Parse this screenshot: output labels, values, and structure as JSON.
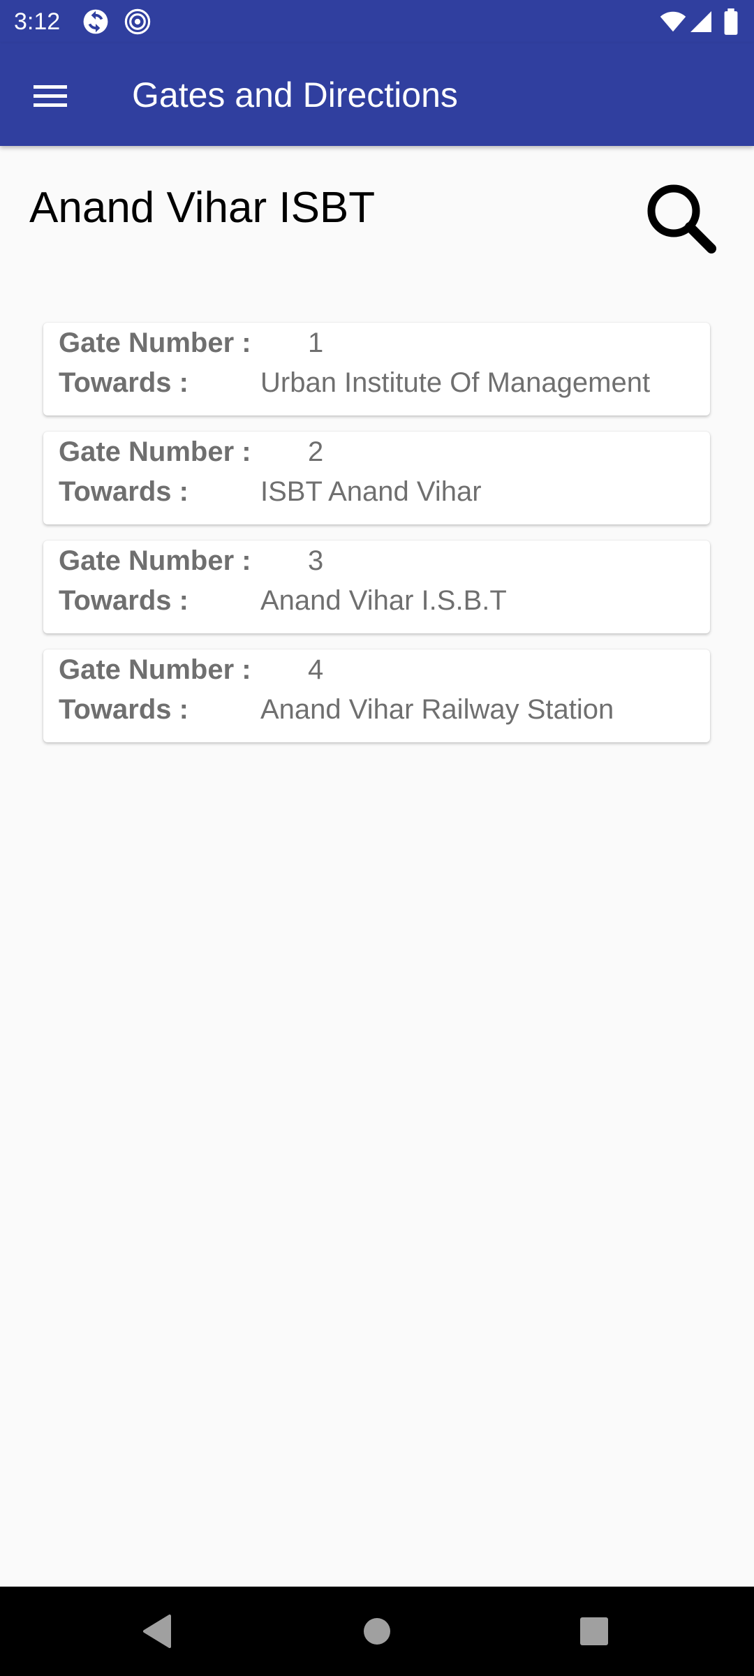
{
  "status_bar": {
    "time": "3:12",
    "left_icons": [
      "sync-icon",
      "hotspot-icon"
    ],
    "right_icons": [
      "wifi-icon",
      "cellular-signal-icon",
      "battery-icon"
    ]
  },
  "app_bar": {
    "title": "Gates and Directions",
    "menu_icon": "hamburger-menu-icon",
    "background_color": "#303f9f"
  },
  "station": {
    "name": "Anand Vihar ISBT",
    "search_icon": "search-icon"
  },
  "gates": [
    {
      "gate_label": "Gate Number :",
      "gate_number": "1",
      "towards_label": "Towards :",
      "towards": "Urban Institute Of Management"
    },
    {
      "gate_label": "Gate Number :",
      "gate_number": "2",
      "towards_label": "Towards :",
      "towards": "ISBT Anand Vihar"
    },
    {
      "gate_label": "Gate Number :",
      "gate_number": "3",
      "towards_label": "Towards :",
      "towards": "Anand Vihar I.S.B.T"
    },
    {
      "gate_label": "Gate Number :",
      "gate_number": "4",
      "towards_label": "Towards :",
      "towards": "Anand Vihar Railway Station"
    }
  ],
  "nav_bar": {
    "icons": [
      "back-icon",
      "home-icon",
      "recents-icon"
    ]
  }
}
